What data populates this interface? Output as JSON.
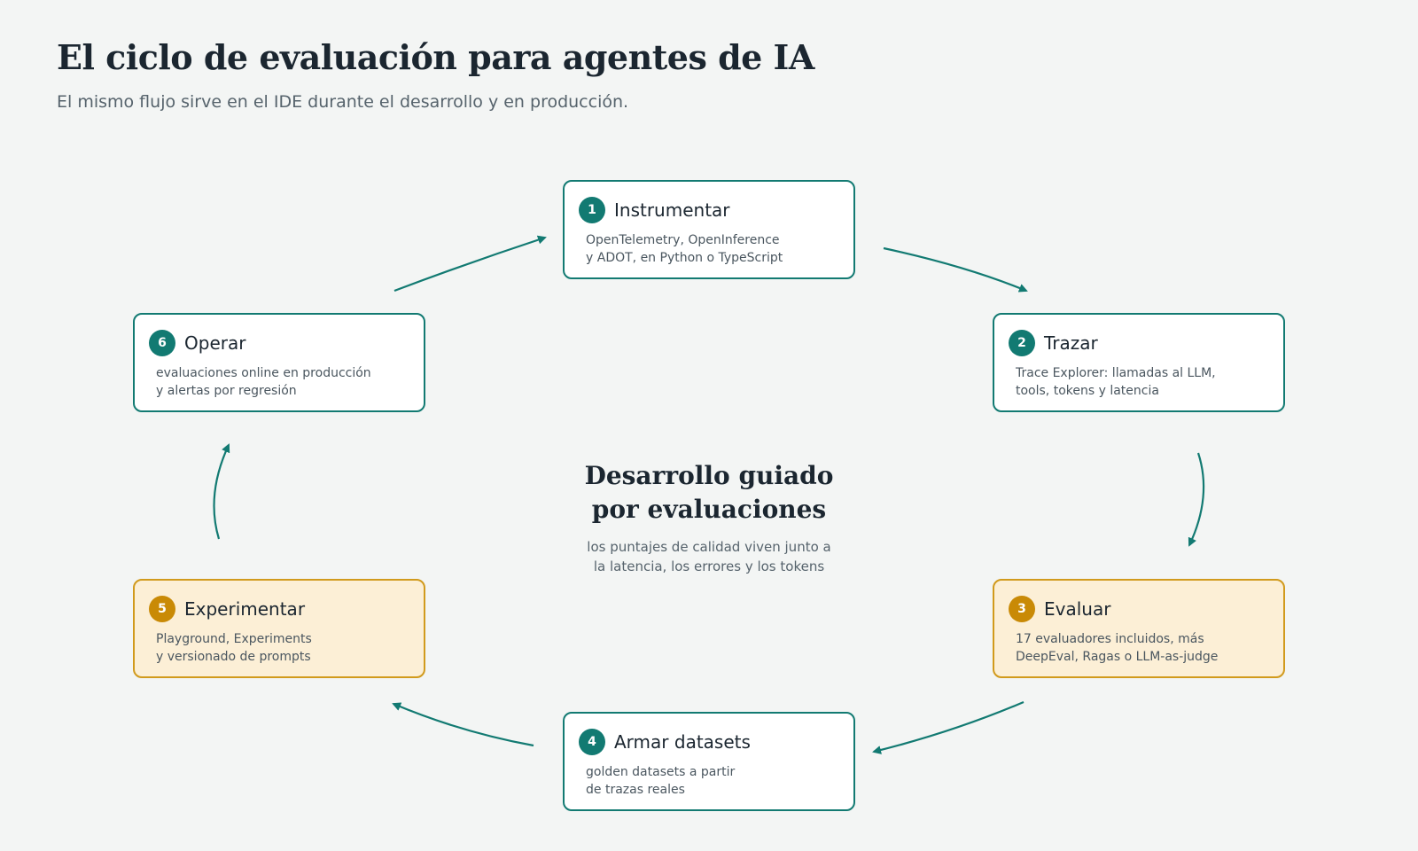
{
  "header": {
    "title": "El ciclo de evaluación para agentes de IA",
    "subtitle": "El mismo flujo sirve en el IDE durante el desarrollo y en producción."
  },
  "center": {
    "title_lines": [
      "Desarrollo guiado",
      "por evaluaciones"
    ],
    "subtitle_lines": [
      "los puntajes de calidad viven junto a",
      "la latencia, los errores y los tokens"
    ]
  },
  "steps": [
    {
      "number": "1",
      "title": "Instrumentar",
      "desc_lines": [
        "OpenTelemetry, OpenInference",
        "y ADOT, en Python o TypeScript"
      ]
    },
    {
      "number": "2",
      "title": "Trazar",
      "desc_lines": [
        "Trace Explorer: llamadas al LLM,",
        "tools, tokens y latencia"
      ]
    },
    {
      "number": "3",
      "title": "Evaluar",
      "desc_lines": [
        "17 evaluadores incluidos, más",
        "DeepEval, Ragas o LLM-as-judge"
      ]
    },
    {
      "number": "4",
      "title": "Armar datasets",
      "desc_lines": [
        "golden datasets a partir",
        "de trazas reales"
      ]
    },
    {
      "number": "5",
      "title": "Experimentar",
      "desc_lines": [
        "Playground, Experiments",
        "y versionado de prompts"
      ]
    },
    {
      "number": "6",
      "title": "Operar",
      "desc_lines": [
        "evaluaciones online en producción",
        "y alertas por regresión"
      ]
    }
  ],
  "colors": {
    "background": "#f3f5f4",
    "accent_teal": "#127a72",
    "accent_amber": "#c98a06",
    "warm_fill": "#fcefd6",
    "warm_border": "#d19a1c"
  }
}
